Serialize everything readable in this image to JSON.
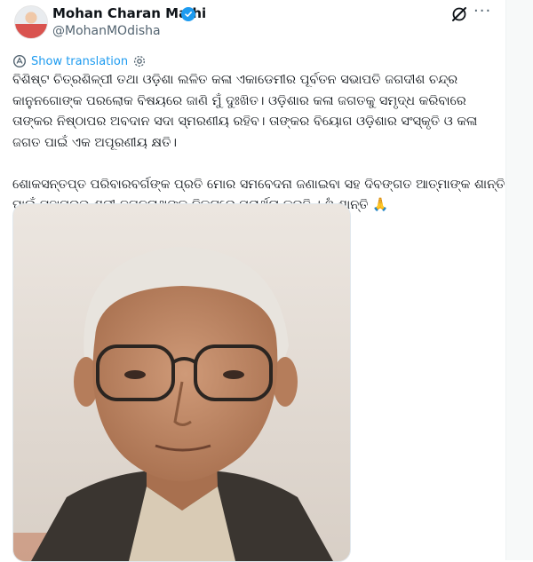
{
  "author": {
    "name": "Mohan Charan Majhi",
    "handle": "@MohanMOdisha",
    "verified": true,
    "avatar_icon": "profile-avatar"
  },
  "header_actions": {
    "grok_icon": "grok-icon",
    "more_label": "···"
  },
  "translation": {
    "label": "Show translation"
  },
  "post": {
    "text": "ବିଶିଷ୍ଟ ଚିତ୍ରଶିଳ୍ପୀ ତଥା ଓଡ଼ିଶା ଲଳିତ କଳା ଏକାଡେମୀର ପୂର୍ବତନ ସଭାପତି ଜଗଦୀଶ ଚନ୍ଦ୍ର କାନୁନଗୋଙ୍କ ପରଲୋକ ବିଷୟରେ ଜାଣି ମୁଁ ଦୁଃଖିତ। ଓଡ଼ିଶାର କଳା ଜଗତକୁ ସମୃଦ୍ଧ କରିବାରେ ତାଙ୍କର ନିଷ୍ଠାପର ଅବଦାନ ସଦା ସ୍ମରଣୀୟ ରହିବ। ତାଙ୍କର ବିୟୋଗ ଓଡ଼ିଶାର ସଂସ୍କୃତି ଓ କଳା ଜଗତ ପାଇଁ ଏକ ଅପୂରଣୀୟ କ୍ଷତି।\n\nଶୋକସନ୍ତପ୍ତ ପରିବାରବର୍ଗଙ୍କ ପ୍ରତି ମୋର ସମବେଦନା ଜଣାଇବା ସହ ଦିବଙ୍ଗତ ଆତ୍ମାଙ୍କ ଶାନ୍ତି ପାଇଁ ମହାପ୍ରଭୁ ଶ୍ରୀ ଜଗନ୍ନାଥଙ୍କ ନିକଟରେ ପ୍ରାର୍ଥନା କରୁଛି । ଓଁ ଶାନ୍ତି 🙏"
  },
  "media": {
    "type": "photo",
    "subject_icon": "portrait-photo"
  },
  "colors": {
    "accent": "#1d9bf0",
    "text": "#0f1419",
    "muted": "#536471"
  }
}
